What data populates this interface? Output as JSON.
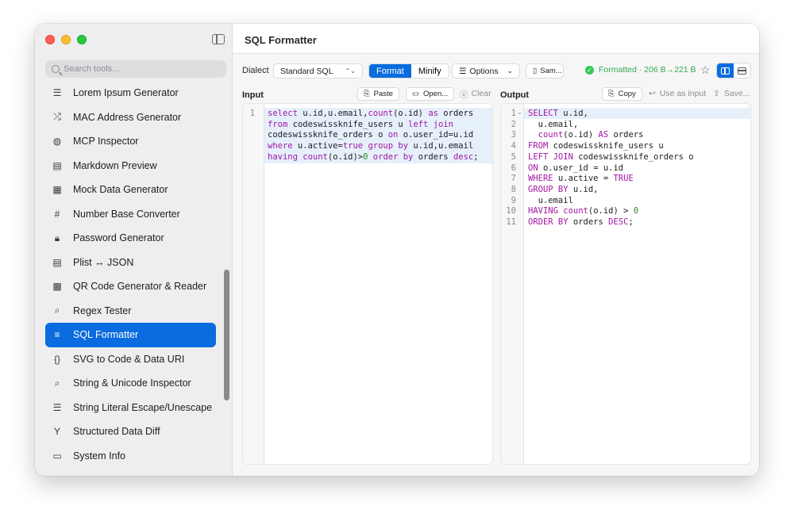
{
  "window": {
    "title": "SQL Formatter",
    "sidebar_search_placeholder": "Search tools..."
  },
  "sidebar": {
    "items": [
      {
        "label": "Lorem Ipsum Generator",
        "icon": "text-lines-icon"
      },
      {
        "label": "MAC Address Generator",
        "icon": "shuffle-icon"
      },
      {
        "label": "MCP Inspector",
        "icon": "globe-icon"
      },
      {
        "label": "Markdown Preview",
        "icon": "document-icon"
      },
      {
        "label": "Mock Data Generator",
        "icon": "table-icon"
      },
      {
        "label": "Number Base Converter",
        "icon": "hash-icon"
      },
      {
        "label": "Password Generator",
        "icon": "lock-icon"
      },
      {
        "label": "Plist ↔ JSON",
        "icon": "list-icon"
      },
      {
        "label": "QR Code Generator & Reader",
        "icon": "qrcode-icon"
      },
      {
        "label": "Regex Tester",
        "icon": "magnify-icon"
      },
      {
        "label": "SQL Formatter",
        "icon": "text-align-icon",
        "selected": true
      },
      {
        "label": "SVG to Code & Data URI",
        "icon": "braces-icon"
      },
      {
        "label": "String & Unicode Inspector",
        "icon": "magnify-icon"
      },
      {
        "label": "String Literal Escape/Unescape",
        "icon": "text-lines-icon"
      },
      {
        "label": "Structured Data Diff",
        "icon": "fork-icon"
      },
      {
        "label": "System Info",
        "icon": "monitor-icon"
      }
    ]
  },
  "toolbar": {
    "dialect_label": "Dialect",
    "dialect_value": "Standard SQL",
    "mode_format": "Format",
    "mode_minify": "Minify",
    "options_label": "Options",
    "sample_label": "Sam...",
    "status": "Formatted · 206 B→221 B"
  },
  "input": {
    "header": "Input",
    "paste": "Paste",
    "open": "Open...",
    "clear": "Clear"
  },
  "output": {
    "header": "Output",
    "copy": "Copy",
    "use_as_input": "Use as input",
    "save": "Save..."
  },
  "colors": {
    "accent": "#0a6cde",
    "success": "#34c759"
  }
}
